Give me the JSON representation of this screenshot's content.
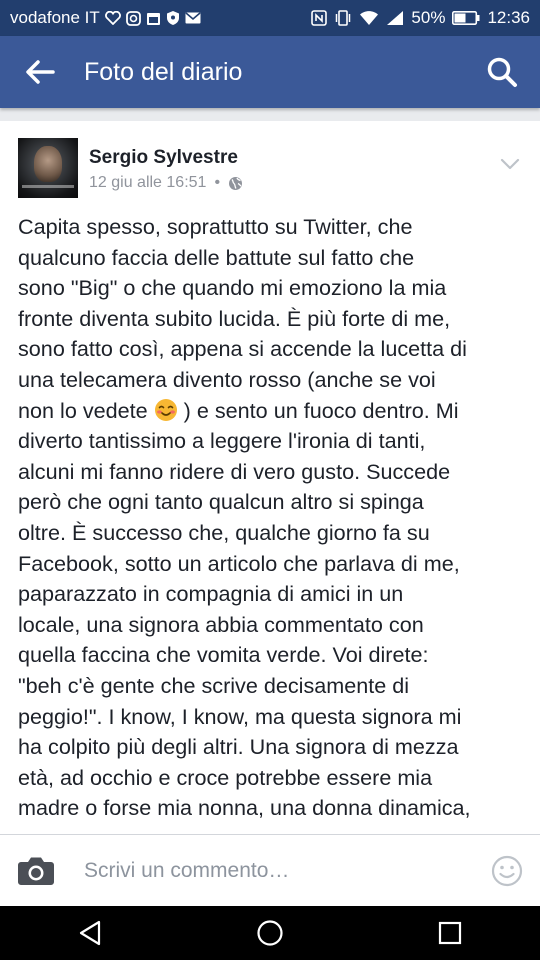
{
  "status_bar": {
    "carrier": "vodafone IT",
    "battery": "50%",
    "time": "12:36",
    "icons_left": [
      "heart-icon",
      "instagram-icon",
      "calendar-icon",
      "shield-icon",
      "mail-icon"
    ],
    "icons_right": [
      "nfc-icon",
      "vibrate-icon",
      "wifi-icon",
      "signal-icon",
      "battery-icon"
    ]
  },
  "app_bar": {
    "title": "Foto del diario",
    "back_icon": "arrow-left-icon",
    "search_icon": "search-icon"
  },
  "post": {
    "author": "Sergio Sylvestre",
    "date": "12 giu alle 16:51",
    "separator": "•",
    "privacy_icon": "globe-icon",
    "menu_icon": "chevron-down-icon",
    "lines": [
      "Capita spesso, soprattutto su Twitter, che",
      "qualcuno faccia delle battute sul fatto che",
      "sono \"Big\" o che quando mi emoziono la mia",
      "fronte diventa subito lucida. È più forte di me,",
      "sono fatto così, appena si accende la lucetta di",
      "una telecamera divento rosso (anche se voi",
      "diverto tantissimo a leggere l'ironia di tanti,",
      "alcuni mi fanno ridere di vero gusto. Succede",
      "però che ogni tanto qualcun altro si spinga",
      "oltre. È successo che, qualche giorno fa su",
      "Facebook, sotto un articolo che parlava di me,",
      "paparazzato in compagnia di amici in un",
      "locale, una signora abbia commentato con",
      "quella faccina che vomita verde. Voi direte:",
      "\"beh c'è gente che scrive decisamente di",
      "peggio!\". I know, I know, ma questa signora mi",
      "ha colpito più degli altri. Una signora di mezza",
      "età, ad occhio e croce potrebbe essere mia",
      "madre o forse mia nonna, una donna dinamica,"
    ],
    "emoji_line_before": "non lo vedete ",
    "emoji_icon": "blushing-smile-emoji",
    "emoji_line_after": " ) e sento un fuoco dentro. Mi"
  },
  "comment_bar": {
    "placeholder": "Scrivi un commento…",
    "camera_icon": "camera-icon",
    "sticker_icon": "smiley-icon"
  },
  "nav_bar": {
    "back": "nav-back-icon",
    "home": "nav-home-icon",
    "recents": "nav-recents-icon"
  },
  "colors": {
    "status_bar": "#223e6e",
    "app_bar": "#3b5998",
    "text": "#1d2129",
    "meta": "#90949c"
  }
}
